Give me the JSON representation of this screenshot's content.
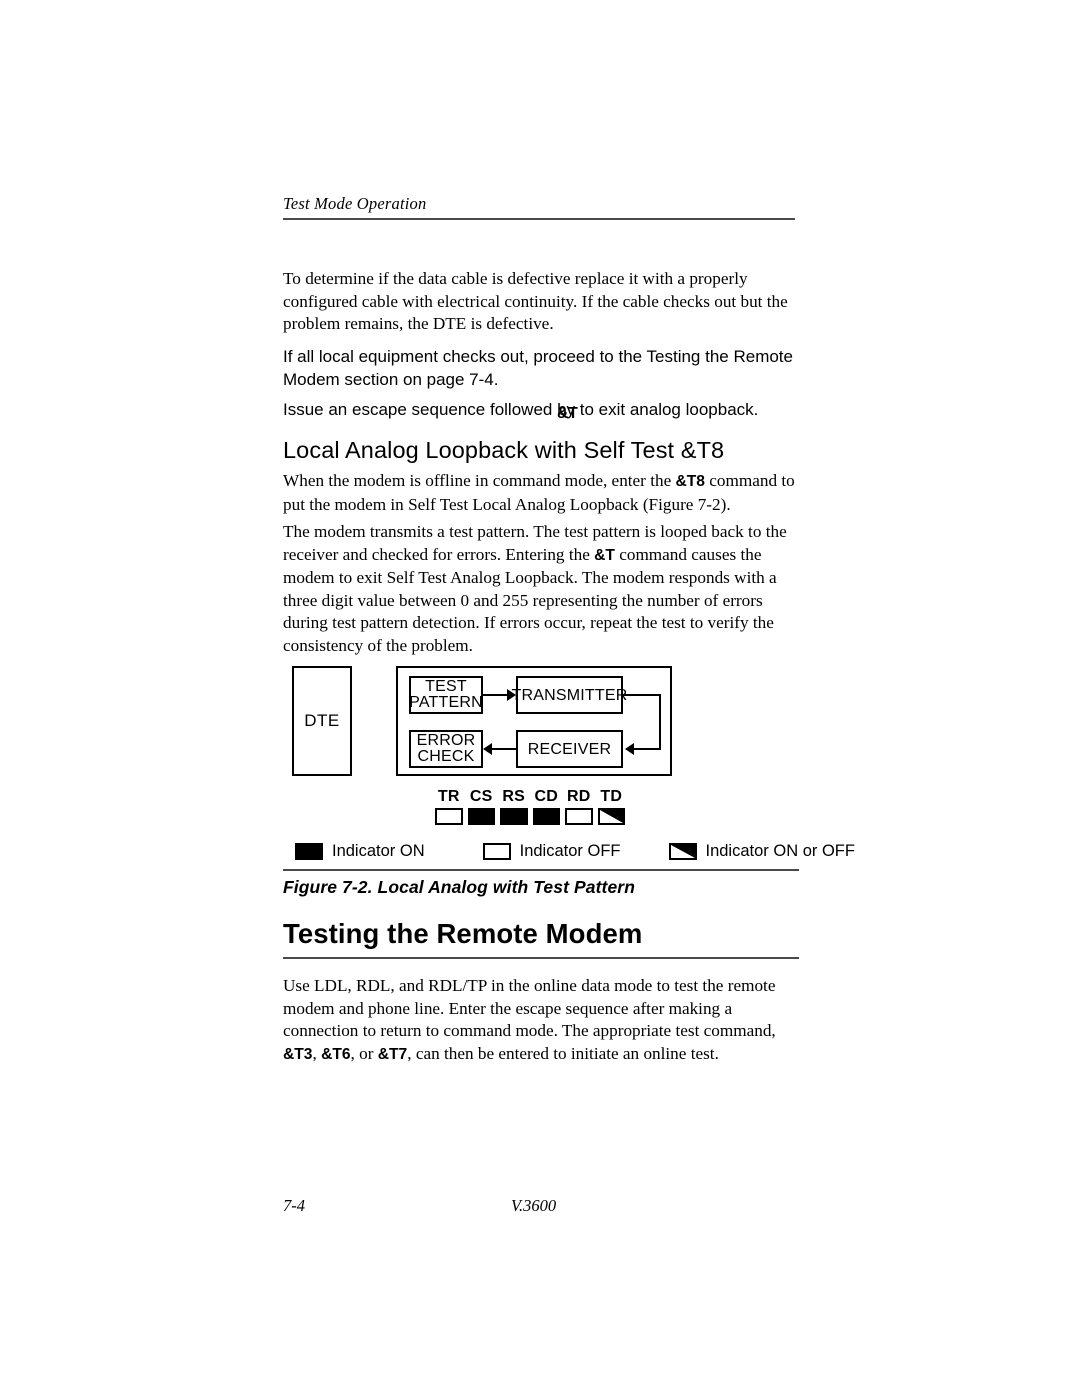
{
  "running_head": {
    "text": "Test Mode Operation"
  },
  "body": {
    "para_1": "To determine if the data cable is defective replace it with a properly configured cable with electrical continuity. If the cable checks out but the problem remains, the DTE is defective.",
    "para_2": "If all local equipment checks out, proceed to the Testing the Remote Modem  section on page 7-4.",
    "para_3_before": "Issue an escape sequence followed by",
    "para_3_command": "&T",
    "para_3_after": " to exit analog loopback."
  },
  "subsection": {
    "heading": "Local Analog Loopback with Self Test   &T8",
    "para_1_a": "When the modem is offline in command mode, enter the ",
    "para_1_cmd": "&T8",
    "para_1_b": " command to put the modem in Self Test Local Analog Loopback (Figure 7-2).",
    "para_2_a": "The modem transmits a test pattern. The test pattern is looped back to the receiver and checked for errors. Entering the ",
    "para_2_cmd": "&T",
    "para_2_b": " command causes the modem to exit Self Test Analog Loopback. The modem responds with a three digit value between 0 and 255 representing the number of errors during test pattern detection. If errors occur, repeat the test to verify the consistency of the problem."
  },
  "figure": {
    "dte_label": "DTE",
    "blocks": {
      "test_pattern_line1": "TEST",
      "test_pattern_line2": "PATTERN",
      "transmitter": "TRANSMITTER",
      "error_check_line1": "ERROR",
      "error_check_line2": "CHECK",
      "receiver": "RECEIVER"
    },
    "indicators": [
      {
        "label": "TR",
        "state": "off"
      },
      {
        "label": "CS",
        "state": "on"
      },
      {
        "label": "RS",
        "state": "on"
      },
      {
        "label": "CD",
        "state": "on"
      },
      {
        "label": "RD",
        "state": "off"
      },
      {
        "label": "TD",
        "state": "on-or-off"
      }
    ],
    "legend": [
      {
        "state": "on",
        "text": "Indicator ON"
      },
      {
        "state": "off",
        "text": "Indicator OFF"
      },
      {
        "state": "on-or-off",
        "text": "Indicator ON or OFF"
      }
    ],
    "caption": "Figure 7-2.  Local Analog with Test Pattern"
  },
  "section": {
    "heading": "Testing the Remote Modem",
    "para_a": "Use LDL, RDL, and RDL/TP in the online data mode to test the remote modem and phone line. Enter the escape sequence after making a connection to return to command mode. The appropriate test command, ",
    "cmd_1": "&T3",
    "sep_1": ", ",
    "cmd_2": "&T6",
    "sep_2": ", or ",
    "cmd_3": "&T7",
    "para_b": ", can then be entered to initiate an online test."
  },
  "footer": {
    "page_number": "7-4",
    "document": "V.3600"
  }
}
